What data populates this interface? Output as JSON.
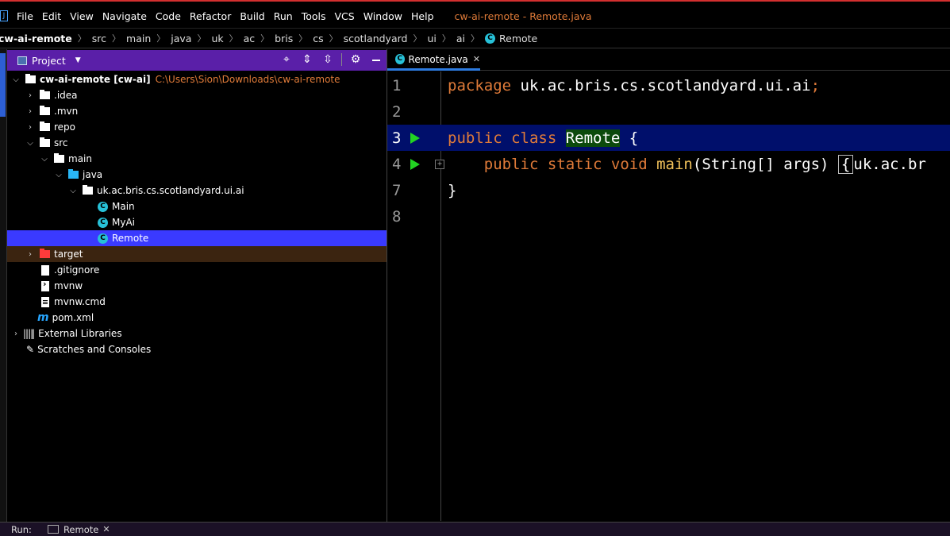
{
  "menu": {
    "items": [
      "File",
      "Edit",
      "View",
      "Navigate",
      "Code",
      "Refactor",
      "Build",
      "Run",
      "Tools",
      "VCS",
      "Window",
      "Help"
    ],
    "window_title": "cw-ai-remote - Remote.java"
  },
  "breadcrumb": [
    "cw-ai-remote",
    "src",
    "main",
    "java",
    "uk",
    "ac",
    "bris",
    "cs",
    "scotlandyard",
    "ui",
    "ai",
    "Remote"
  ],
  "project_panel": {
    "title": "Project",
    "tree": [
      {
        "label": "cw-ai-remote [cw-ai]",
        "path": "C:\\Users\\Sion\\Downloads\\cw-ai-remote"
      },
      {
        "label": ".idea"
      },
      {
        "label": ".mvn"
      },
      {
        "label": "repo"
      },
      {
        "label": "src"
      },
      {
        "label": "main"
      },
      {
        "label": "java"
      },
      {
        "label": "uk.ac.bris.cs.scotlandyard.ui.ai"
      },
      {
        "label": "Main"
      },
      {
        "label": "MyAi"
      },
      {
        "label": "Remote"
      },
      {
        "label": "target"
      },
      {
        "label": ".gitignore"
      },
      {
        "label": "mvnw"
      },
      {
        "label": "mvnw.cmd"
      },
      {
        "label": "pom.xml"
      },
      {
        "label": "External Libraries"
      },
      {
        "label": "Scratches and Consoles"
      }
    ]
  },
  "editor": {
    "tab_label": "Remote.java",
    "lines": [
      {
        "number": "1",
        "parts": [
          "package",
          " uk.ac.bris.cs.scotlandyard.ui.ai",
          ";"
        ]
      },
      {
        "number": "2"
      },
      {
        "number": "3",
        "parts": [
          "public class ",
          "Remote",
          " {"
        ]
      },
      {
        "number": "4",
        "parts": [
          "public static void ",
          "main",
          "(String[] args)",
          "{",
          "uk.ac.br"
        ]
      },
      {
        "number": "7",
        "parts": [
          "}"
        ]
      },
      {
        "number": "8"
      }
    ]
  },
  "runbar": {
    "label": "Run:",
    "tab": "Remote"
  },
  "colors": {
    "accent": "#d32f2f",
    "project_header": "#5a1fa8",
    "selection": "#3a3aff",
    "caret_line": "#000f6b",
    "keyword": "#e07b39"
  }
}
